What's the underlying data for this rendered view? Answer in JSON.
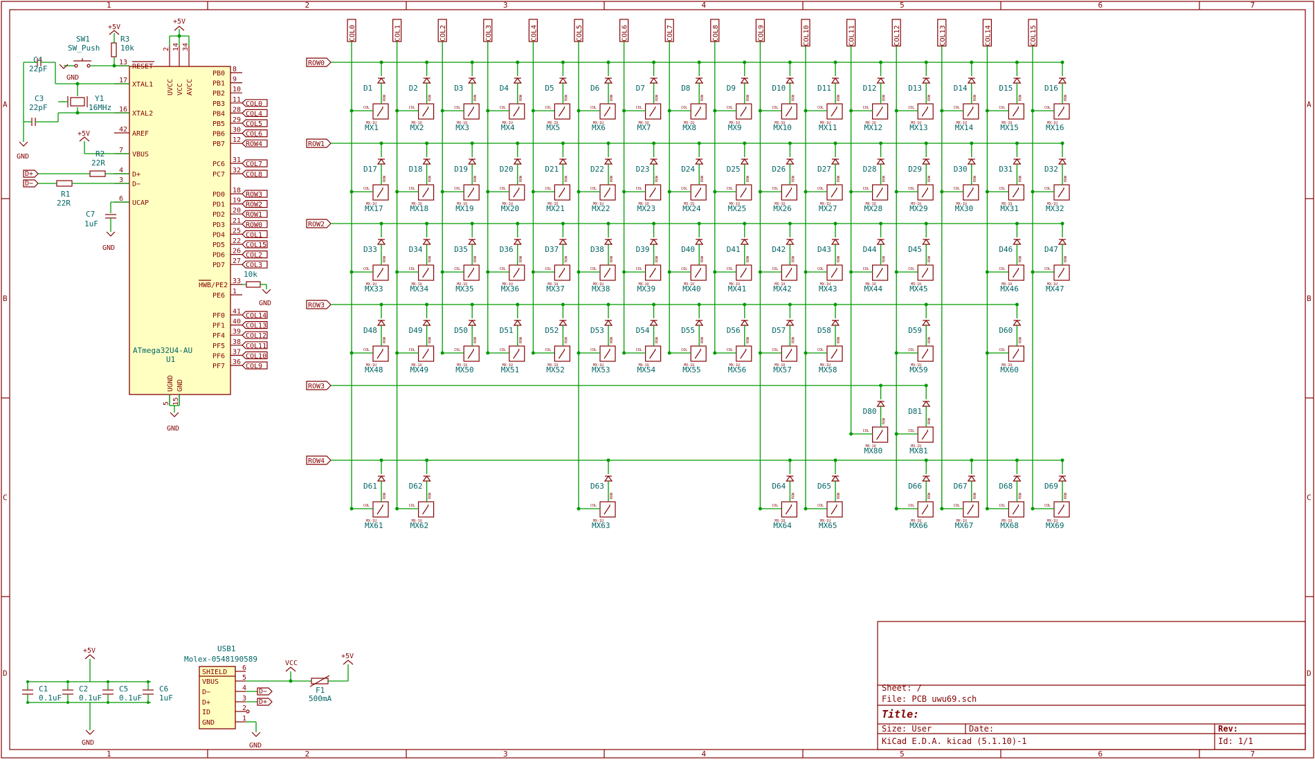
{
  "frame": {
    "col_labels": [
      "1",
      "2",
      "3",
      "4",
      "5",
      "6",
      "7"
    ],
    "row_labels": [
      "A",
      "B",
      "C",
      "D"
    ]
  },
  "mcu": {
    "ref": "U1",
    "value": "ATmega32U4-AU",
    "top_pins": [
      {
        "n": "2",
        "name": "UVCC"
      },
      {
        "n": "14",
        "name": "VCC"
      },
      {
        "n": "34",
        "name": "AVCC"
      }
    ],
    "bottom_pins": [
      {
        "n": "5",
        "name": "UGND"
      },
      {
        "n": "15",
        "name": "GND"
      }
    ],
    "left_pins": [
      {
        "n": "13",
        "name": "RESET"
      },
      {
        "n": "17",
        "name": "XTAL1"
      },
      {
        "n": "16",
        "name": "XTAL2"
      },
      {
        "n": "42",
        "name": "AREF"
      },
      {
        "n": "7",
        "name": "VBUS"
      },
      {
        "n": "4",
        "name": "D+"
      },
      {
        "n": "3",
        "name": "D−"
      },
      {
        "n": "6",
        "name": "UCAP"
      }
    ],
    "right_pins": [
      {
        "n": "8",
        "name": "PB0",
        "net": ""
      },
      {
        "n": "9",
        "name": "PB1",
        "net": ""
      },
      {
        "n": "10",
        "name": "PB2",
        "net": ""
      },
      {
        "n": "11",
        "name": "PB3",
        "net": "COL0"
      },
      {
        "n": "28",
        "name": "PB4",
        "net": "COL4"
      },
      {
        "n": "29",
        "name": "PB5",
        "net": "COL5"
      },
      {
        "n": "30",
        "name": "PB6",
        "net": "COL6"
      },
      {
        "n": "12",
        "name": "PB7",
        "net": "ROW4"
      },
      {
        "n": "31",
        "name": "PC6",
        "net": "COL7"
      },
      {
        "n": "32",
        "name": "PC7",
        "net": "COL8"
      },
      {
        "n": "18",
        "name": "PD0",
        "net": "ROW3"
      },
      {
        "n": "19",
        "name": "PD1",
        "net": "ROW2"
      },
      {
        "n": "20",
        "name": "PD2",
        "net": "ROW1"
      },
      {
        "n": "21",
        "name": "PD3",
        "net": "ROW0"
      },
      {
        "n": "25",
        "name": "PD4",
        "net": "COL1"
      },
      {
        "n": "22",
        "name": "PD5",
        "net": "COL15"
      },
      {
        "n": "26",
        "name": "PD6",
        "net": "COL2"
      },
      {
        "n": "27",
        "name": "PD7",
        "net": "COL3"
      },
      {
        "n": "33",
        "name": "HWB/PE2",
        "net": ""
      },
      {
        "n": "1",
        "name": "PE6",
        "net": ""
      },
      {
        "n": "41",
        "name": "PF0",
        "net": "COL14"
      },
      {
        "n": "40",
        "name": "PF1",
        "net": "COL13"
      },
      {
        "n": "39",
        "name": "PF4",
        "net": "COL12"
      },
      {
        "n": "38",
        "name": "PF5",
        "net": "COL11"
      },
      {
        "n": "37",
        "name": "PF6",
        "net": "COL10"
      },
      {
        "n": "36",
        "name": "PF7",
        "net": "COL9"
      }
    ]
  },
  "parts": {
    "sw1_ref": "SW1",
    "sw1_val": "SW_Push",
    "r3_ref": "R3",
    "r3_val": "10k",
    "c4_ref": "C4",
    "c4_val": "22pF",
    "c3_ref": "C3",
    "c3_val": "22pF",
    "y1_ref": "Y1",
    "y1_val": "16MHz",
    "r2_ref": "R2",
    "r2_val": "22R",
    "r1_ref": "R1",
    "r1_val": "22R",
    "c7_ref": "C7",
    "c7_val": "1uF",
    "rhwb_val": "10k",
    "c1_ref": "C1",
    "c1_val": "0.1uF",
    "c2_ref": "C2",
    "c2_val": "0.1uF",
    "c5_ref": "C5",
    "c5_val": "0.1uF",
    "c6_ref": "C6",
    "c6_val": "1uF",
    "usb_ref": "USB1",
    "usb_val": "Molex-0548190589",
    "usb_pins": [
      {
        "n": "6",
        "name": "SHIELD"
      },
      {
        "n": "5",
        "name": "VBUS"
      },
      {
        "n": "4",
        "name": "D−"
      },
      {
        "n": "3",
        "name": "D+"
      },
      {
        "n": "2",
        "name": "ID"
      },
      {
        "n": "1",
        "name": "GND"
      }
    ],
    "f1_ref": "F1",
    "f1_val": "500mA"
  },
  "power": {
    "p5v": "+5V",
    "gnd": "GND",
    "vcc": "VCC"
  },
  "nets": {
    "dplus": "D+",
    "dminus": "D−"
  },
  "matrix": {
    "cols": [
      "COL0",
      "COL1",
      "COL2",
      "COL3",
      "COL4",
      "COL5",
      "COL6",
      "COL7",
      "COL8",
      "COL9",
      "COL10",
      "COL11",
      "COL12",
      "COL13",
      "COL14",
      "COL15"
    ],
    "rows": [
      "ROW0",
      "ROW1",
      "ROW2",
      "ROW3",
      "ROW3",
      "ROW4"
    ],
    "sw_col_label": "COL",
    "sw_row_label": "ROW",
    "footprint_label": "MX-1U",
    "keys": [
      {
        "d": "D1",
        "mx": "MX1",
        "row": 0,
        "col": 0
      },
      {
        "d": "D2",
        "mx": "MX2",
        "row": 0,
        "col": 1
      },
      {
        "d": "D3",
        "mx": "MX3",
        "row": 0,
        "col": 2
      },
      {
        "d": "D4",
        "mx": "MX4",
        "row": 0,
        "col": 3
      },
      {
        "d": "D5",
        "mx": "MX5",
        "row": 0,
        "col": 4
      },
      {
        "d": "D6",
        "mx": "MX6",
        "row": 0,
        "col": 5
      },
      {
        "d": "D7",
        "mx": "MX7",
        "row": 0,
        "col": 6
      },
      {
        "d": "D8",
        "mx": "MX8",
        "row": 0,
        "col": 7
      },
      {
        "d": "D9",
        "mx": "MX9",
        "row": 0,
        "col": 8
      },
      {
        "d": "D10",
        "mx": "MX10",
        "row": 0,
        "col": 9
      },
      {
        "d": "D11",
        "mx": "MX11",
        "row": 0,
        "col": 10
      },
      {
        "d": "D12",
        "mx": "MX12",
        "row": 0,
        "col": 11
      },
      {
        "d": "D13",
        "mx": "MX13",
        "row": 0,
        "col": 12
      },
      {
        "d": "D14",
        "mx": "MX14",
        "row": 0,
        "col": 13
      },
      {
        "d": "D15",
        "mx": "MX15",
        "row": 0,
        "col": 14
      },
      {
        "d": "D16",
        "mx": "MX16",
        "row": 0,
        "col": 15
      },
      {
        "d": "D17",
        "mx": "MX17",
        "row": 1,
        "col": 0
      },
      {
        "d": "D18",
        "mx": "MX18",
        "row": 1,
        "col": 1
      },
      {
        "d": "D19",
        "mx": "MX19",
        "row": 1,
        "col": 2
      },
      {
        "d": "D20",
        "mx": "MX20",
        "row": 1,
        "col": 3
      },
      {
        "d": "D21",
        "mx": "MX21",
        "row": 1,
        "col": 4
      },
      {
        "d": "D22",
        "mx": "MX22",
        "row": 1,
        "col": 5
      },
      {
        "d": "D23",
        "mx": "MX23",
        "row": 1,
        "col": 6
      },
      {
        "d": "D24",
        "mx": "MX24",
        "row": 1,
        "col": 7
      },
      {
        "d": "D25",
        "mx": "MX25",
        "row": 1,
        "col": 8
      },
      {
        "d": "D26",
        "mx": "MX26",
        "row": 1,
        "col": 9
      },
      {
        "d": "D27",
        "mx": "MX27",
        "row": 1,
        "col": 10
      },
      {
        "d": "D28",
        "mx": "MX28",
        "row": 1,
        "col": 11
      },
      {
        "d": "D29",
        "mx": "MX29",
        "row": 1,
        "col": 12
      },
      {
        "d": "D30",
        "mx": "MX30",
        "row": 1,
        "col": 13
      },
      {
        "d": "D31",
        "mx": "MX31",
        "row": 1,
        "col": 14
      },
      {
        "d": "D32",
        "mx": "MX32",
        "row": 1,
        "col": 15
      },
      {
        "d": "D33",
        "mx": "MX33",
        "row": 2,
        "col": 0
      },
      {
        "d": "D34",
        "mx": "MX34",
        "row": 2,
        "col": 1
      },
      {
        "d": "D35",
        "mx": "MX35",
        "row": 2,
        "col": 2
      },
      {
        "d": "D36",
        "mx": "MX36",
        "row": 2,
        "col": 3
      },
      {
        "d": "D37",
        "mx": "MX37",
        "row": 2,
        "col": 4
      },
      {
        "d": "D38",
        "mx": "MX38",
        "row": 2,
        "col": 5
      },
      {
        "d": "D39",
        "mx": "MX39",
        "row": 2,
        "col": 6
      },
      {
        "d": "D40",
        "mx": "MX40",
        "row": 2,
        "col": 7
      },
      {
        "d": "D41",
        "mx": "MX41",
        "row": 2,
        "col": 8
      },
      {
        "d": "D42",
        "mx": "MX42",
        "row": 2,
        "col": 9
      },
      {
        "d": "D43",
        "mx": "MX43",
        "row": 2,
        "col": 10
      },
      {
        "d": "D44",
        "mx": "MX44",
        "row": 2,
        "col": 11
      },
      {
        "d": "D45",
        "mx": "MX45",
        "row": 2,
        "col": 12
      },
      {
        "d": "D46",
        "mx": "MX46",
        "row": 2,
        "col": 14
      },
      {
        "d": "D47",
        "mx": "MX47",
        "row": 2,
        "col": 15
      },
      {
        "d": "D48",
        "mx": "MX48",
        "row": 3,
        "col": 0
      },
      {
        "d": "D49",
        "mx": "MX49",
        "row": 3,
        "col": 1
      },
      {
        "d": "D50",
        "mx": "MX50",
        "row": 3,
        "col": 2
      },
      {
        "d": "D51",
        "mx": "MX51",
        "row": 3,
        "col": 3
      },
      {
        "d": "D52",
        "mx": "MX52",
        "row": 3,
        "col": 4
      },
      {
        "d": "D53",
        "mx": "MX53",
        "row": 3,
        "col": 5
      },
      {
        "d": "D54",
        "mx": "MX54",
        "row": 3,
        "col": 6
      },
      {
        "d": "D55",
        "mx": "MX55",
        "row": 3,
        "col": 7
      },
      {
        "d": "D56",
        "mx": "MX56",
        "row": 3,
        "col": 8
      },
      {
        "d": "D57",
        "mx": "MX57",
        "row": 3,
        "col": 9
      },
      {
        "d": "D58",
        "mx": "MX58",
        "row": 3,
        "col": 10
      },
      {
        "d": "D59",
        "mx": "MX59",
        "row": 3,
        "col": 12
      },
      {
        "d": "D60",
        "mx": "MX60",
        "row": 3,
        "col": 14
      },
      {
        "d": "D80",
        "mx": "MX80",
        "row": 4,
        "col": 11
      },
      {
        "d": "D81",
        "mx": "MX81",
        "row": 4,
        "col": 12
      },
      {
        "d": "D61",
        "mx": "MX61",
        "row": 5,
        "col": 0
      },
      {
        "d": "D62",
        "mx": "MX62",
        "row": 5,
        "col": 1
      },
      {
        "d": "D63",
        "mx": "MX63",
        "row": 5,
        "col": 5
      },
      {
        "d": "D64",
        "mx": "MX64",
        "row": 5,
        "col": 9
      },
      {
        "d": "D65",
        "mx": "MX65",
        "row": 5,
        "col": 10
      },
      {
        "d": "D66",
        "mx": "MX66",
        "row": 5,
        "col": 12
      },
      {
        "d": "D67",
        "mx": "MX67",
        "row": 5,
        "col": 13
      },
      {
        "d": "D68",
        "mx": "MX68",
        "row": 5,
        "col": 14
      },
      {
        "d": "D69",
        "mx": "MX69",
        "row": 5,
        "col": 15
      }
    ]
  },
  "title_block": {
    "sheet": "Sheet: /",
    "file": "File: PCB uwu69.sch",
    "title": "Title:",
    "size": "Size: User",
    "date": "Date:",
    "rev": "Rev:",
    "tool": "KiCad E.D.A.  kicad (5.1.10)-1",
    "id": "Id: 1/1"
  }
}
